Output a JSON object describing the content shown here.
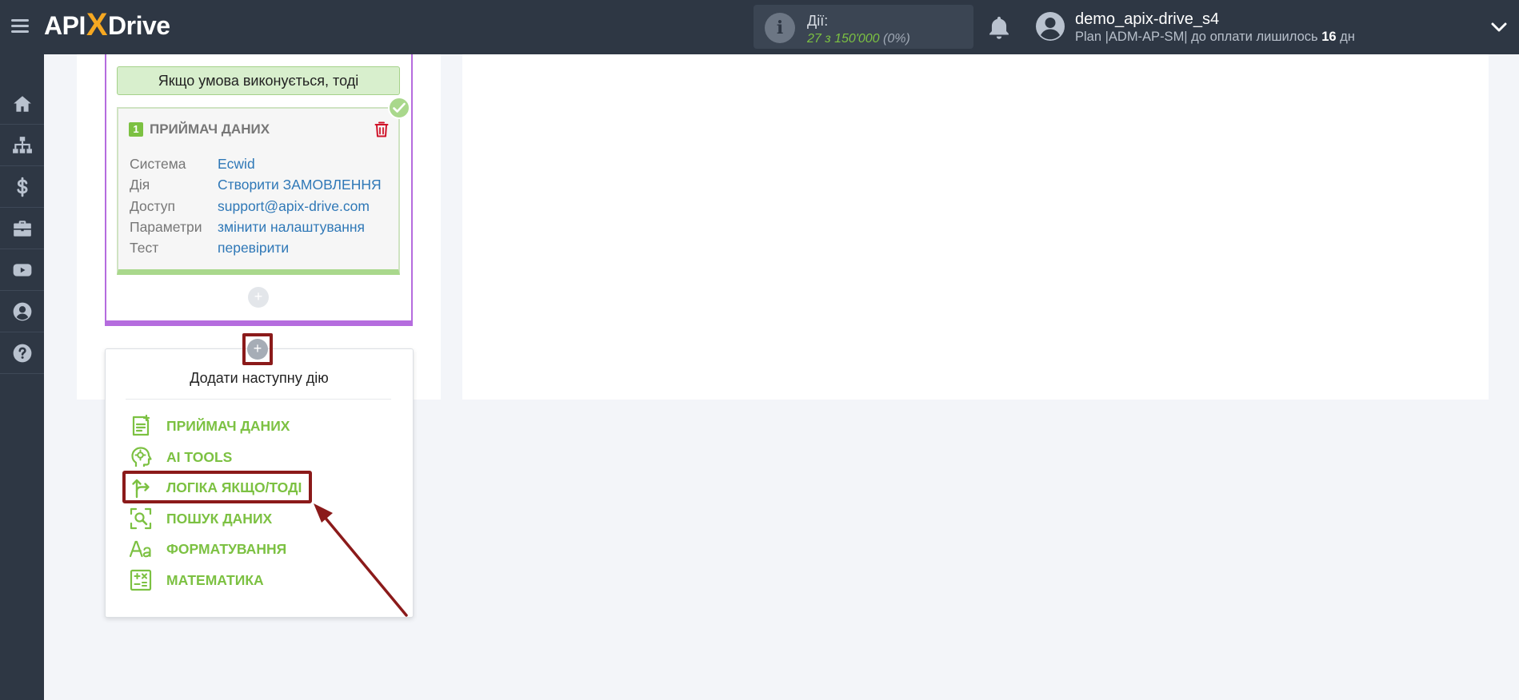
{
  "header": {
    "logo": {
      "api": "API",
      "x": "X",
      "drive": "Drive"
    },
    "actions": {
      "label": "Дії:",
      "value": "27 з 150'000",
      "percent": "(0%)"
    },
    "user": {
      "name": "demo_apix-drive_s4",
      "plan_prefix": "Plan |ADM-AP-SM| до оплати лишилось ",
      "days": "16",
      "days_suffix": " дн"
    }
  },
  "sidebar": {
    "items": [
      {
        "icon": "home-icon"
      },
      {
        "icon": "sitemap-icon"
      },
      {
        "icon": "dollar-icon"
      },
      {
        "icon": "briefcase-icon"
      },
      {
        "icon": "youtube-icon"
      },
      {
        "icon": "user-circle-icon"
      },
      {
        "icon": "help-icon"
      }
    ]
  },
  "condition": {
    "banner": "Якщо умова виконується, тоді"
  },
  "receiver_card": {
    "number": "1",
    "title": "ПРИЙМАЧ ДАНИХ",
    "rows": [
      {
        "label": "Система",
        "value": "Ecwid"
      },
      {
        "label": "Дія",
        "value": "Створити ЗАМОВЛЕННЯ"
      },
      {
        "label": "Доступ",
        "value": "support@apix-drive.com"
      },
      {
        "label": "Параметри",
        "value": "змінити налаштування"
      },
      {
        "label": "Тест",
        "value": "перевірити"
      }
    ]
  },
  "add_button": {
    "symbol": "+"
  },
  "dropdown": {
    "title": "Додати наступну дію",
    "items": [
      {
        "label": "ПРИЙМАЧ ДАНИХ",
        "icon": "receiver-icon"
      },
      {
        "label": "AI TOOLS",
        "icon": "ai-head-icon"
      },
      {
        "label": "ЛОГІКА ЯКЩО/ТОДІ",
        "icon": "branch-icon"
      },
      {
        "label": "ПОШУК ДАНИХ",
        "icon": "search-data-icon"
      },
      {
        "label": "ФОРМАТУВАННЯ",
        "icon": "format-icon"
      },
      {
        "label": "МАТЕМАТИКА",
        "icon": "math-icon"
      }
    ]
  },
  "colors": {
    "header_bg": "#2e3744",
    "accent_green": "#7cc142",
    "purple_border": "#b56cde",
    "highlight_red": "#8b1a1a",
    "link_blue": "#2f78b7"
  }
}
